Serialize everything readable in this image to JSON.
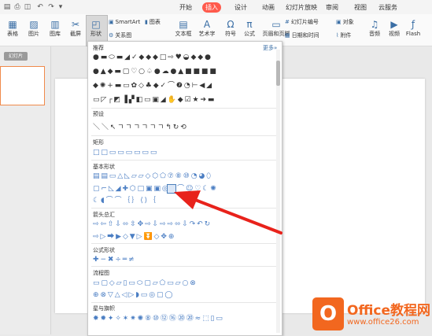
{
  "title_bar": {
    "tabs": [
      "开始",
      "插入",
      "设计",
      "动画",
      "幻灯片放映",
      "审阅",
      "视图",
      "云服务"
    ],
    "active_tab": "插入"
  },
  "ribbon": {
    "table": "表格",
    "picture": "图片",
    "gallery": "图库",
    "screenshot": "截屏",
    "shape": "形状",
    "smartart": "SmartArt",
    "chart": "图表",
    "relation": "关系图",
    "textbox": "文本框",
    "wordart": "艺术字",
    "symbol": "符号",
    "formula": "公式",
    "header_footer": "页眉和页脚",
    "slide_number": "幻灯片编号",
    "datetime": "日期和时间",
    "object": "对象",
    "attachment": "附件",
    "audio": "音频",
    "video": "视频",
    "flash": "Flash"
  },
  "slides_panel": {
    "tab_label": "幻灯片"
  },
  "shape_panel": {
    "more_label": "更多",
    "sections": {
      "recommended": "推荐",
      "preset": "预设",
      "rectangle": "矩形",
      "basic": "基本形状",
      "arrows": "箭头总汇",
      "equation": "公式形状",
      "flowchart": "流程图",
      "stars": "星与旗帜"
    },
    "rows": {
      "rec1": "●▬⬭▬◢✓◆◆◆□⇨♥◒◆◆●",
      "rec2": "●▲◆▬▢♡○♤●☁●▲■■■■",
      "rec3": "◆✺+▬▭✿◇♣◆✓⌒❼◔⊢◀◢",
      "rec4": "▭◸┌◩▐▞◧▭▣◢✋◆☑★➔▬",
      "preset1": "＼＼↖ㄱㄱㄱㄱㄱㄱ↰↻⟲",
      "rect1": "□□▭▭▭▭▭▭",
      "basic1": "▤▤▭△◺▱▱◇⬡⬠⑦⑧⑩◔◕⬯",
      "basic2": "▢⌐◺◢✚⬡□▣▣◎⊘⌒☺♡☾✺",
      "basic3": "☾◖⌒⌒｛｝⟨⟩｛",
      "arr1": "⇨⇦⇧⇩⬄⇳✥⇨⇩⇨⇨⬄⇩↷↶↻",
      "arr2": "⇨▷⮕▶◇▼▷⏬◇✥⊕",
      "eq1": "✚−✖÷═≠",
      "flow1": "▭▢◇▱▯▭⬭▢▱⬠▭▱○⊗",
      "flow2": "⊕⊗▽△◁▷◗▭◎▢◯",
      "star1": "✸✹✦✧✶✷✺⑧⑩⑫⑯⑳⑳≈⬚▯▭"
    }
  },
  "watermark": {
    "mark": "O",
    "title": "Office教程网",
    "url": "www.office26.com"
  }
}
